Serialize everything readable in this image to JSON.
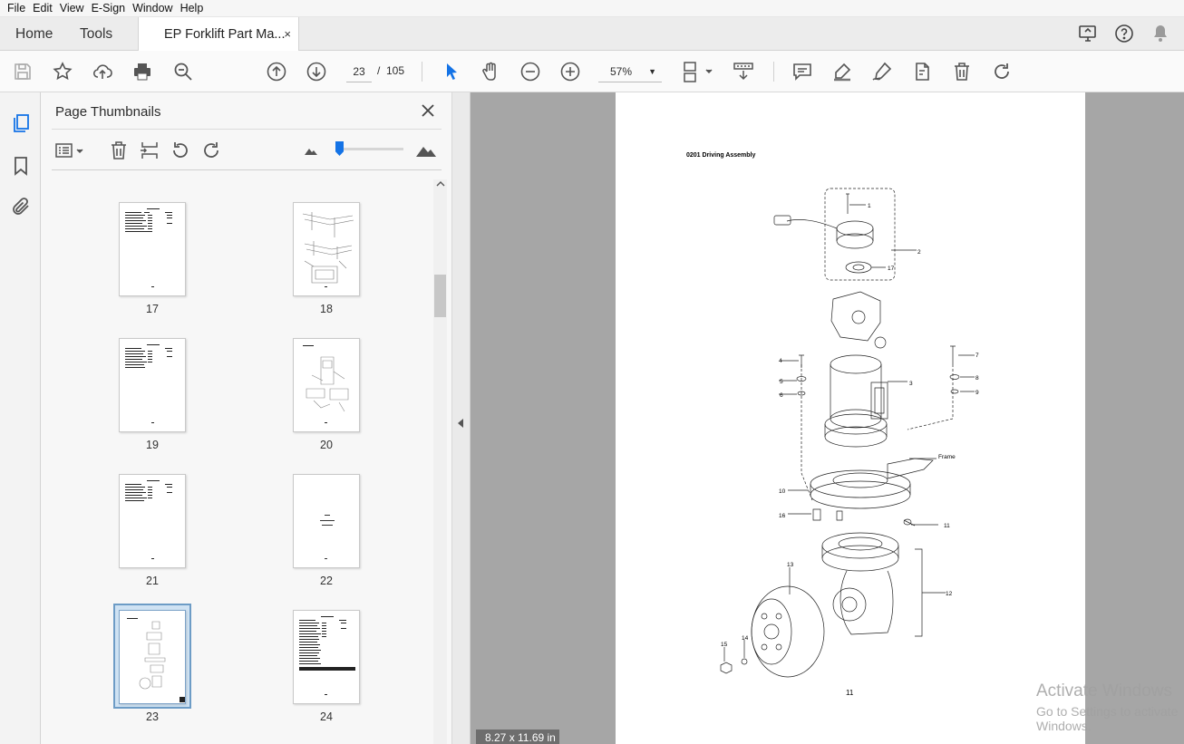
{
  "menu": [
    "File",
    "Edit",
    "View",
    "E-Sign",
    "Window",
    "Help"
  ],
  "tabs": {
    "home": "Home",
    "tools": "Tools",
    "document": "EP Forklift Part Ma...",
    "close": "×"
  },
  "toolbar": {
    "current_page": "23",
    "page_separator": "/",
    "total_pages": "105",
    "zoom": "57%"
  },
  "panel": {
    "title": "Page Thumbnails",
    "thumbnails": [
      {
        "label": "17"
      },
      {
        "label": "18"
      },
      {
        "label": "19"
      },
      {
        "label": "20"
      },
      {
        "label": "21"
      },
      {
        "label": "22"
      },
      {
        "label": "23",
        "selected": true
      },
      {
        "label": "24"
      }
    ]
  },
  "document": {
    "page_title": "0201 Driving Assembly",
    "page_number": "11",
    "size_badge": "8.27 x 11.69 in",
    "callouts": [
      "1",
      "2",
      "17",
      "4",
      "5",
      "6",
      "7",
      "8",
      "9",
      "3",
      "Frame",
      "10",
      "16",
      "11",
      "13",
      "12",
      "15",
      "14"
    ]
  },
  "watermark": {
    "line1": "Activate Windows",
    "line2": "Go to Settings to activate Windows."
  },
  "colors": {
    "accent": "#1473e6",
    "doc_background": "#a6a6a6",
    "selection": "#cfe2f3"
  }
}
